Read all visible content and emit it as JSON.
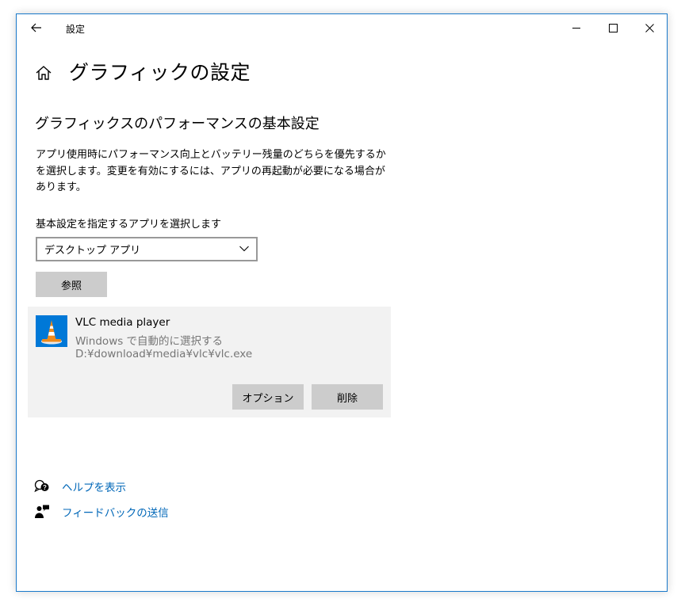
{
  "window": {
    "title": "設定",
    "controls": {
      "minimize": "minimize-icon",
      "maximize": "maximize-icon",
      "close": "close-icon"
    }
  },
  "page": {
    "title": "グラフィックの設定"
  },
  "section": {
    "title": "グラフィックスのパフォーマンスの基本設定",
    "description": "アプリ使用時にパフォーマンス向上とバッテリー残量のどちらを優先するかを選択します。変更を有効にするには、アプリの再起動が必要になる場合があります。"
  },
  "app_selector": {
    "label": "基本設定を指定するアプリを選択します",
    "selected": "デスクトップ アプリ",
    "browse_label": "参照"
  },
  "apps": [
    {
      "name": "VLC media player",
      "mode": "Windows で自動的に選択する",
      "path": "D:¥download¥media¥vlc¥vlc.exe",
      "options_label": "オプション",
      "remove_label": "削除"
    }
  ],
  "links": {
    "help": "ヘルプを表示",
    "feedback": "フィードバックの送信"
  },
  "colors": {
    "accent": "#0078d7",
    "link": "#0067b8",
    "button": "#cccccc",
    "card": "#f2f2f2",
    "border": "#1979ca"
  }
}
